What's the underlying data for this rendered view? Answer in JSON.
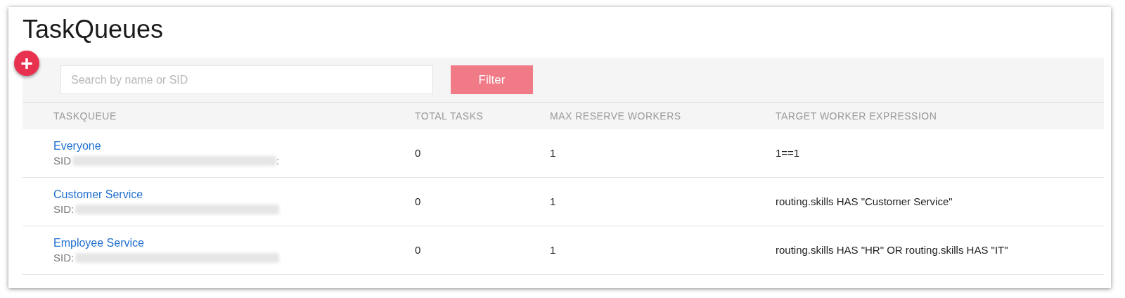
{
  "title": "TaskQueues",
  "add_button": {
    "label": "+"
  },
  "search": {
    "placeholder": "Search by name or SID"
  },
  "filter_button": {
    "label": "Filter"
  },
  "table": {
    "columns": [
      "TASKQUEUE",
      "TOTAL TASKS",
      "MAX RESERVE WORKERS",
      "TARGET WORKER EXPRESSION"
    ],
    "rows": [
      {
        "name": "Everyone",
        "sid_label": "SID",
        "sid_suffix": ":",
        "total_tasks": "0",
        "max_reserve_workers": "1",
        "target_worker_expression": "1==1"
      },
      {
        "name": "Customer Service",
        "sid_label": "SID:",
        "total_tasks": "0",
        "max_reserve_workers": "1",
        "target_worker_expression": "routing.skills HAS \"Customer Service\""
      },
      {
        "name": "Employee Service",
        "sid_label": "SID:",
        "total_tasks": "0",
        "max_reserve_workers": "1",
        "target_worker_expression": "routing.skills HAS \"HR\" OR routing.skills HAS \"IT\""
      }
    ]
  }
}
